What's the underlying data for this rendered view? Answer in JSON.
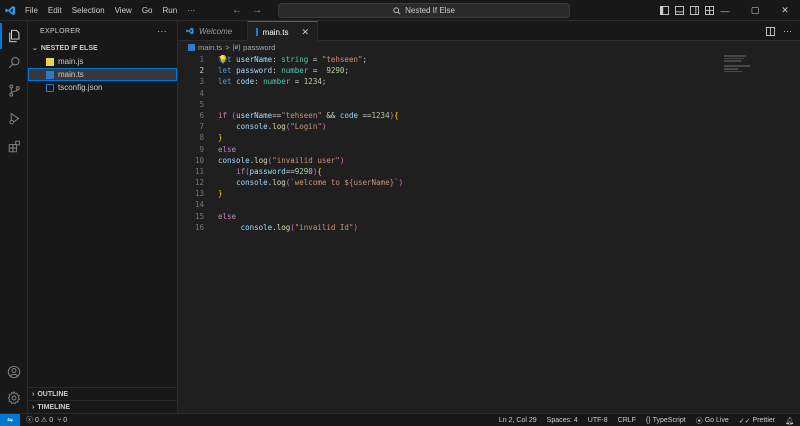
{
  "titlebar": {
    "menu": [
      "File",
      "Edit",
      "Selection",
      "View",
      "Go",
      "Run"
    ],
    "more": "···",
    "search_text": "Nested If Else",
    "window_controls": [
      "—",
      "▢",
      "✕"
    ]
  },
  "sidebar": {
    "header": "EXPLORER",
    "more": "···",
    "folder": "NESTED IF ELSE",
    "files": [
      {
        "name": "main.js",
        "icon": "js-file-icon"
      },
      {
        "name": "main.ts",
        "icon": "ts-file-icon"
      },
      {
        "name": "tsconfig.json",
        "icon": "tsconfig-file-icon"
      }
    ],
    "sections": [
      "OUTLINE",
      "TIMELINE"
    ]
  },
  "tabs": [
    {
      "label": "Welcome",
      "active": false
    },
    {
      "label": "main.ts",
      "active": true,
      "close": "✕"
    }
  ],
  "breadcrumb": {
    "file": "main.ts",
    "separator": ">",
    "symbol_badge": "[ø]",
    "symbol": "password"
  },
  "editor": {
    "current_line": 2,
    "line_numbers": [
      "1",
      "2",
      "3",
      "4",
      "5",
      "6",
      "7",
      "8",
      "9",
      "10",
      "11",
      "12",
      "13",
      "14",
      "15",
      "16"
    ],
    "lines": [
      "let userName: string = \"tehseen\";",
      "let password: number =  9290;",
      "let code: number = 1234;",
      "",
      "",
      "if (userName==\"tehseen\" && code ==1234){",
      "    console.log(\"Login\")",
      "}",
      "else",
      "console.log(\"invailid user\")",
      "    if(password==9290){",
      "    console.log(`welcome to ${userName}`)",
      "}",
      "",
      "else",
      "     console.log(\"invailid Id\")"
    ]
  },
  "statusbar": {
    "remote": "⇋",
    "errors": "0",
    "warnings": "0",
    "ports": "0",
    "position": "Ln 2, Col 29",
    "spaces": "Spaces: 4",
    "encoding": "UTF-8",
    "eol": "CRLF",
    "language": "TypeScript",
    "go_live": "Go Live",
    "prettier": "Prettier"
  },
  "colors": {
    "accent": "#0078d4",
    "background": "#1f1f1f",
    "chrome": "#181818"
  }
}
